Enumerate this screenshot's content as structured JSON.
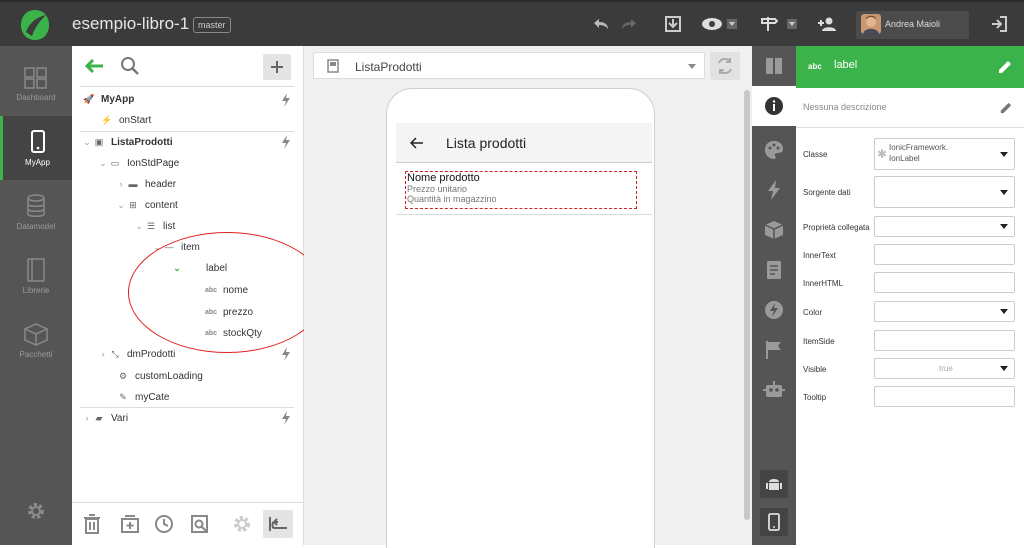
{
  "app": {
    "project": "esempio-libro-1",
    "branch": "master",
    "user": "Andrea Maioli",
    "accent": "#3cb34a"
  },
  "nav": [
    {
      "label": "Dashboard",
      "icon": "dashboard-icon"
    },
    {
      "label": "MyApp",
      "icon": "phone-icon",
      "active": true
    },
    {
      "label": "Datamodel",
      "icon": "database-icon"
    },
    {
      "label": "Librerie",
      "icon": "book-icon"
    },
    {
      "label": "Pacchetti",
      "icon": "package-icon"
    }
  ],
  "tree": {
    "myapp": "MyApp",
    "onstart": "onStart",
    "listaprodotti": "ListaProdotti",
    "ionstdpage": "IonStdPage",
    "header": "header",
    "content": "content",
    "list": "list",
    "item": "item",
    "label": "label",
    "nome": "nome",
    "prezzo": "prezzo",
    "stockqty": "stockQty",
    "dmprodotti": "dmProdotti",
    "customloading": "customLoading",
    "mycate": "myCate",
    "vari": "Vari",
    "abc": "abc"
  },
  "canvas": {
    "page": "ListaProdotti",
    "preview_title": "Lista prodotti",
    "line1": "Nome prodotto",
    "line2": "Prezzo unitario",
    "line3": "Quantità in magazzino"
  },
  "props": {
    "type_badge": "abc",
    "title": "label",
    "description": "Nessuna descrizione",
    "classe_label": "Classe",
    "classe_value1": "IonicFramework.",
    "classe_value2": "IonLabel",
    "sorgente": "Sorgente dati",
    "proprieta": "Proprietà collegata",
    "innertext": "InnerText",
    "innerhtml": "InnerHTML",
    "color": "Color",
    "itemside": "ItemSide",
    "visible": "Visible",
    "visible_value": "true",
    "tooltip": "Tooltip"
  }
}
